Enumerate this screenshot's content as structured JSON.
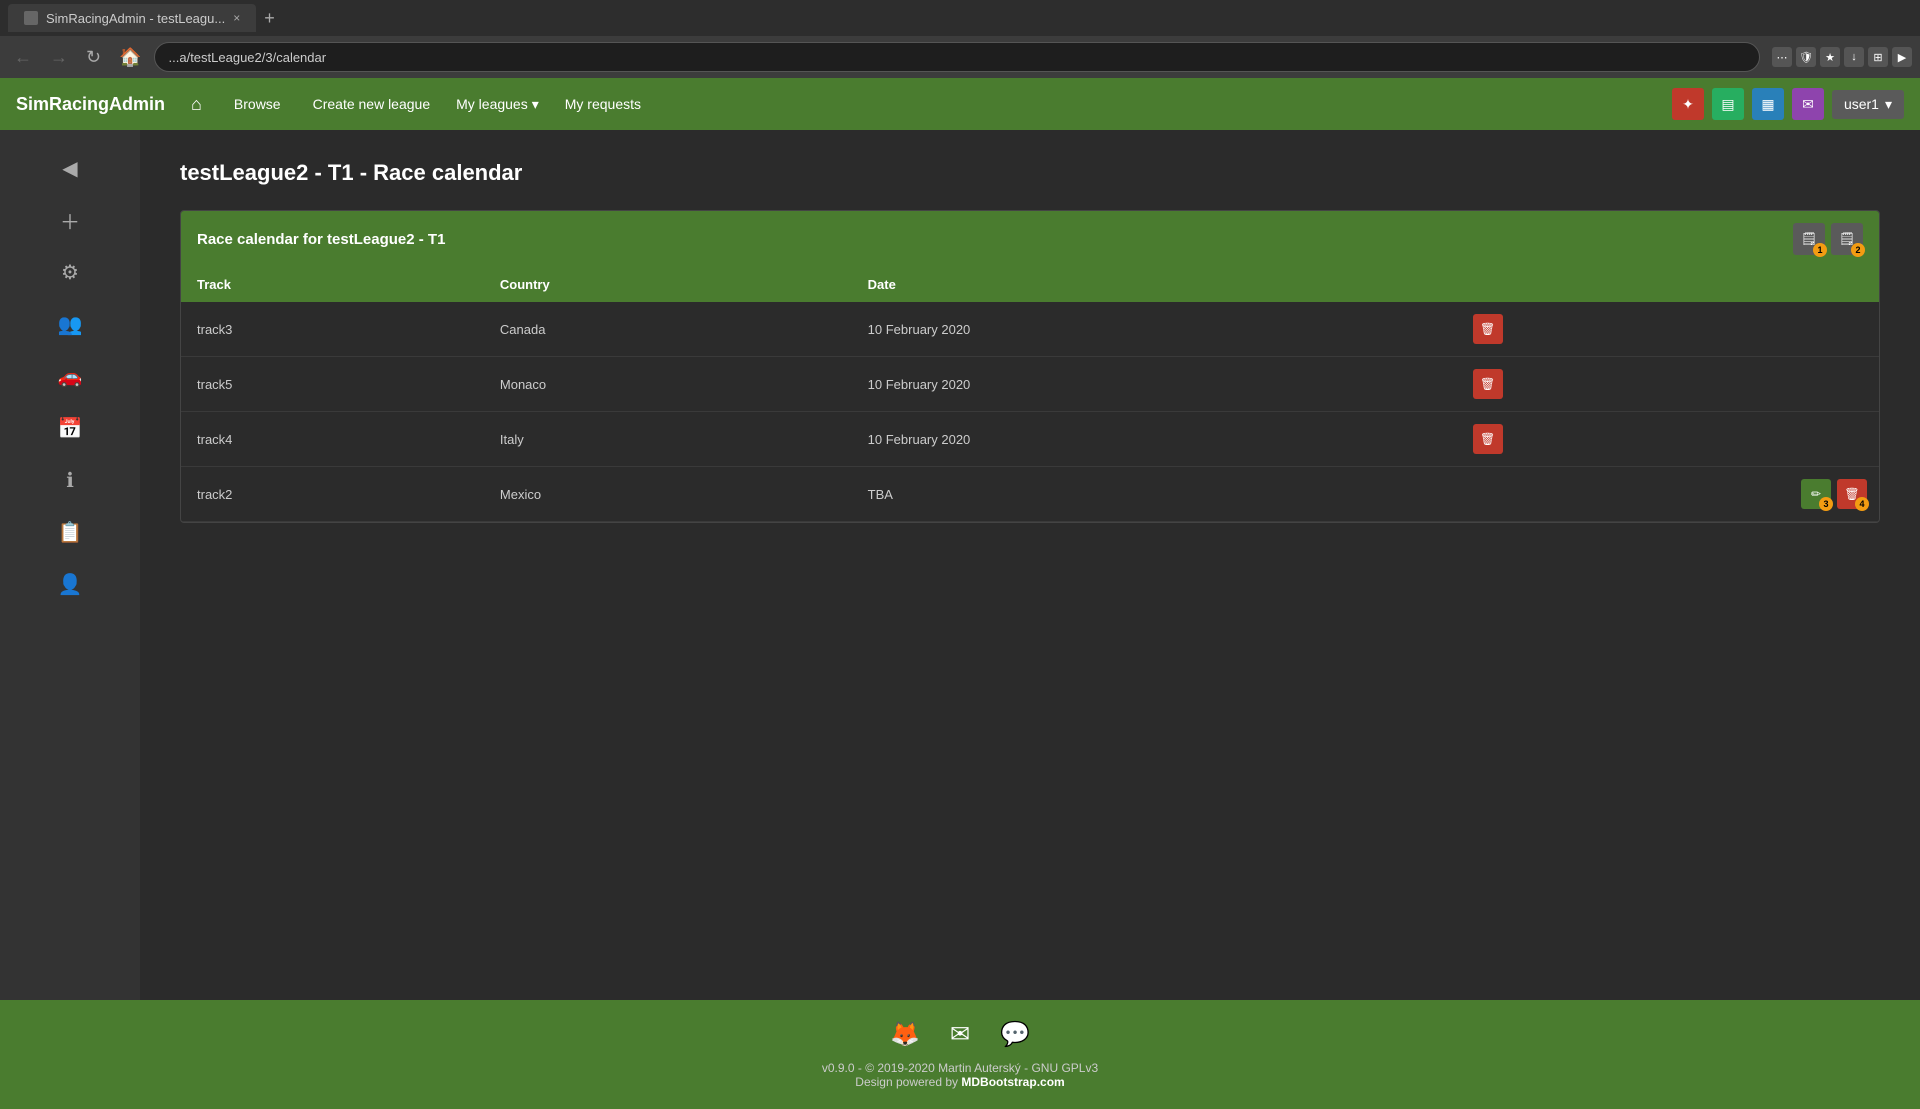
{
  "browser": {
    "tab_title": "SimRacingAdmin - testLeagu...",
    "tab_close": "×",
    "new_tab": "+",
    "url": "...a/testLeague2/3/calendar",
    "nav_back": "←",
    "nav_forward": "→",
    "nav_refresh": "↻",
    "nav_home": "🏠"
  },
  "navbar": {
    "brand": "SimRacingAdmin",
    "home_icon": "⌂",
    "browse": "Browse",
    "create_new_league": "Create new league",
    "my_leagues": "My leagues",
    "my_leagues_arrow": "▾",
    "my_requests": "My requests",
    "user": "user1",
    "user_arrow": "▾"
  },
  "page": {
    "title": "testLeague2 - T1 - Race calendar"
  },
  "calendar": {
    "header_title": "Race calendar for testLeague2 - T1",
    "btn1_badge": "1",
    "btn2_badge": "2",
    "columns": [
      "Track",
      "Country",
      "Date"
    ],
    "rows": [
      {
        "track": "track3",
        "country": "Canada",
        "date": "10 February 2020",
        "has_edit": false,
        "del_badge": null
      },
      {
        "track": "track5",
        "country": "Monaco",
        "date": "10 February 2020",
        "has_edit": false,
        "del_badge": null
      },
      {
        "track": "track4",
        "country": "Italy",
        "date": "10 February 2020",
        "has_edit": false,
        "del_badge": null
      },
      {
        "track": "track2",
        "country": "Mexico",
        "date": "TBA",
        "has_edit": true,
        "edit_badge": "3",
        "del_badge": "4"
      }
    ]
  },
  "sidebar": {
    "icons": [
      "◀",
      "+",
      "⚙",
      "👥",
      "🚗",
      "📅",
      "ℹ",
      "📋",
      "👤"
    ]
  },
  "footer": {
    "copyright": "v0.9.0 - © 2019-2020 Martin Auterský - GNU GPLv3",
    "design": "Design powered by ",
    "design_link": "MDBootstrap.com"
  }
}
